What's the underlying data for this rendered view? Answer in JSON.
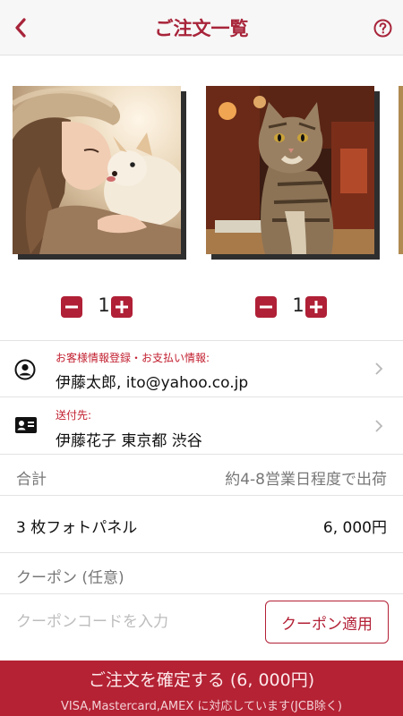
{
  "header": {
    "title": "ご注文一覧",
    "back_icon": "chevron-left-icon",
    "help_icon": "question-circle-icon"
  },
  "items": [
    {
      "quantity": "1"
    },
    {
      "quantity": "1"
    }
  ],
  "customer": {
    "label": "お客様情報登録・お支払い情報:",
    "value": "伊藤太郎, ito@yahoo.co.jp"
  },
  "shipping": {
    "label": "送付先:",
    "value": "伊藤花子 東京都 渋谷"
  },
  "total": {
    "label": "合計",
    "note": "約4-8営業日程度で出荷"
  },
  "line_item": {
    "label": "3 枚フォトパネル",
    "price": "6, 000円"
  },
  "coupon": {
    "label": "クーポン (任意)",
    "placeholder": "クーポンコードを入力",
    "button_label": "クーポン適用"
  },
  "confirm": {
    "label": "ご注文を確定する (6, 000円)",
    "sub_label": "VISA,Mastercard,AMEX に対応しています(JCB除く)"
  },
  "colors": {
    "accent": "#b42234",
    "label_red": "#c21f2f",
    "header_bg": "#f7f7f7"
  }
}
